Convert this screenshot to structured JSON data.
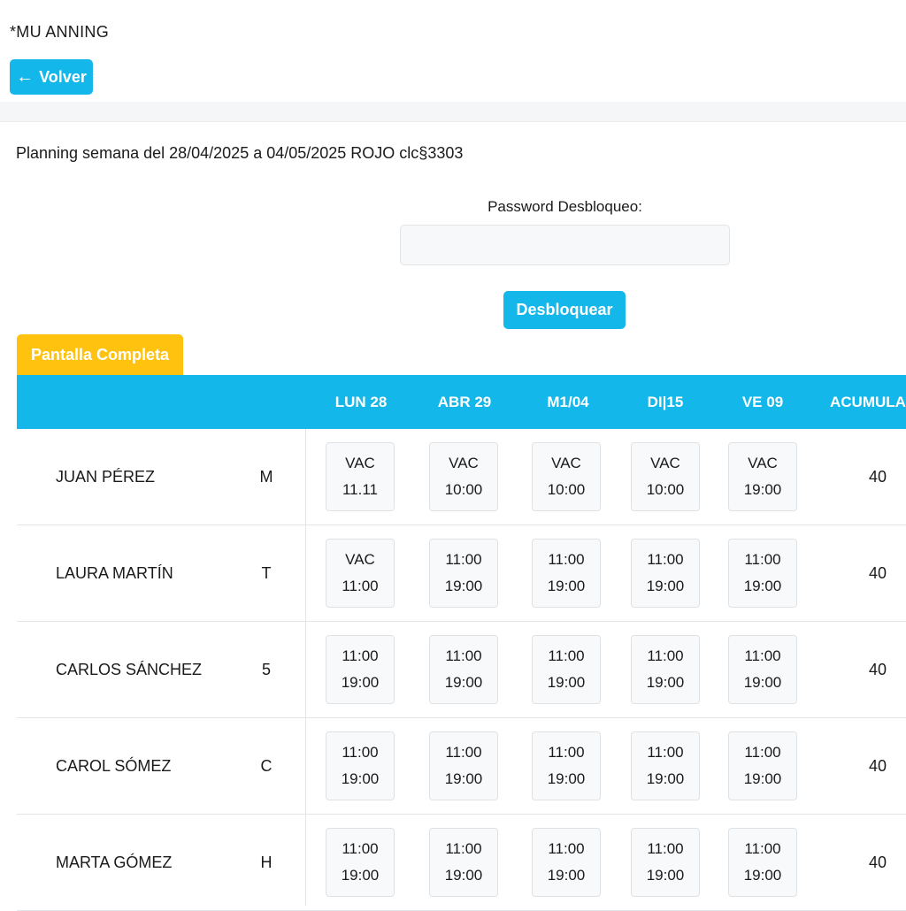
{
  "app": {
    "title": "*MU ANNING"
  },
  "nav": {
    "back_label": "Volver",
    "back_icon": "arrow-left-icon"
  },
  "week": {
    "title": "Planning semana del 28/04/2025 a 04/05/2025 ROJO clc§3303"
  },
  "unlock": {
    "label": "Password Desbloqueo:",
    "value": "",
    "placeholder": "",
    "button_label": "Desbloquear"
  },
  "fullscreen": {
    "label": "Pantalla Completa"
  },
  "colors": {
    "accent": "#13b7ea",
    "fullscreen_tab": "#ffc20e",
    "cell_bg": "#f8f9fa"
  },
  "grid": {
    "columns": [
      "LUN 28",
      "ABR 29",
      "M1/04",
      "DI|15",
      "VE 09",
      "ACUMULAD"
    ],
    "rows": [
      {
        "name": "JUAN PÉREZ",
        "shift": "M",
        "days": [
          [
            "VAC",
            "11.11"
          ],
          [
            "VAC",
            "10:00"
          ],
          [
            "VAC",
            "10:00"
          ],
          [
            "VAC",
            "10:00"
          ],
          [
            "VAC",
            "19:00"
          ]
        ],
        "total": "40"
      },
      {
        "name": "LAURA MARTÍN",
        "shift": "T",
        "days": [
          [
            "VAC",
            "11:00"
          ],
          [
            "11:00",
            "19:00"
          ],
          [
            "11:00",
            "19:00"
          ],
          [
            "11:00",
            "19:00"
          ],
          [
            "11:00",
            "19:00"
          ]
        ],
        "total": "40"
      },
      {
        "name": "CARLOS SÁNCHEZ",
        "shift": "5",
        "days": [
          [
            "11:00",
            "19:00"
          ],
          [
            "11:00",
            "19:00"
          ],
          [
            "11:00",
            "19:00"
          ],
          [
            "11:00",
            "19:00"
          ],
          [
            "11:00",
            "19:00"
          ]
        ],
        "total": "40"
      },
      {
        "name": "CAROL SÓMEZ",
        "shift": "C",
        "days": [
          [
            "11:00",
            "19:00"
          ],
          [
            "11:00",
            "19:00"
          ],
          [
            "11:00",
            "19:00"
          ],
          [
            "11:00",
            "19:00"
          ],
          [
            "11:00",
            "19:00"
          ]
        ],
        "total": "40"
      },
      {
        "name": "MARTA GÓMEZ",
        "shift": "H",
        "days": [
          [
            "11:00",
            "19:00"
          ],
          [
            "11:00",
            "19:00"
          ],
          [
            "11:00",
            "19:00"
          ],
          [
            "11:00",
            "19:00"
          ],
          [
            "11:00",
            "19:00"
          ]
        ],
        "total": "40"
      }
    ]
  }
}
